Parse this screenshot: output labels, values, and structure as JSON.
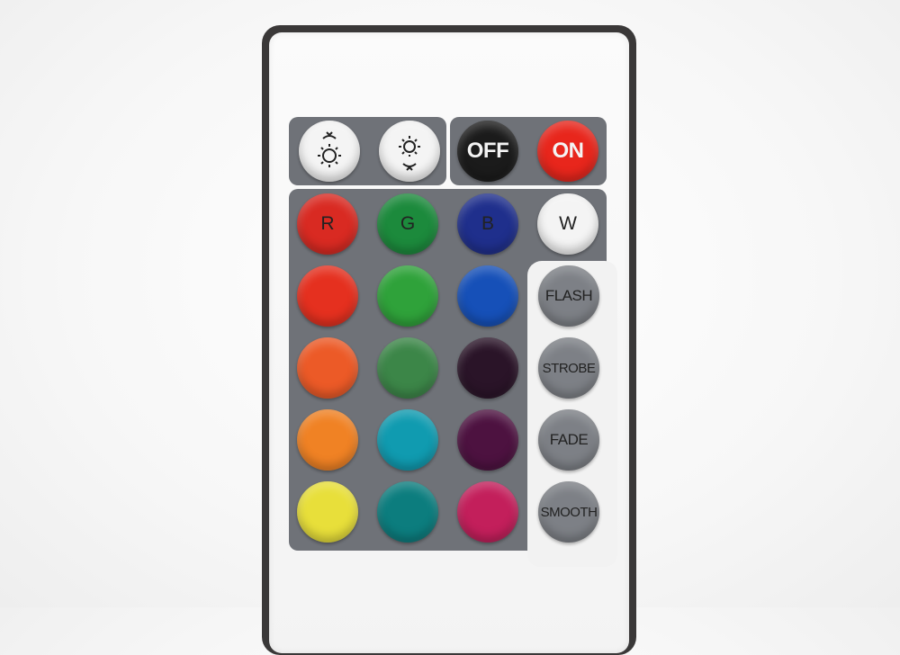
{
  "remote": {
    "power_row": {
      "brightness_up": {
        "icon": "brightness-up-icon",
        "color": "#f4f4f4"
      },
      "brightness_down": {
        "icon": "brightness-down-icon",
        "color": "#f4f4f4"
      },
      "off_label": "OFF",
      "off_color": "#1b1b1b",
      "on_label": "ON",
      "on_color": "#e8261c"
    },
    "rgbw_row": [
      {
        "label": "R",
        "color": "#d92a22"
      },
      {
        "label": "G",
        "color": "#1c8a3c"
      },
      {
        "label": "B",
        "color": "#1f2f8c"
      },
      {
        "label": "W",
        "color": "#f4f4f4"
      }
    ],
    "color_grid": [
      [
        "#e5301f",
        "#2fa23a",
        "#1650b8"
      ],
      [
        "#ec5a27",
        "#3c8648",
        "#2a1428"
      ],
      [
        "#f08224",
        "#109bb0",
        "#4d1240"
      ],
      [
        "#e8df3a",
        "#0c7d7e",
        "#c31f5b"
      ]
    ],
    "modes": [
      {
        "label": "FLASH",
        "color": "#7d8086"
      },
      {
        "label": "STROBE",
        "color": "#7d8086"
      },
      {
        "label": "FADE",
        "color": "#7d8086"
      },
      {
        "label": "SMOOTH",
        "color": "#7d8086"
      }
    ],
    "panel_color": "#6f7278"
  }
}
